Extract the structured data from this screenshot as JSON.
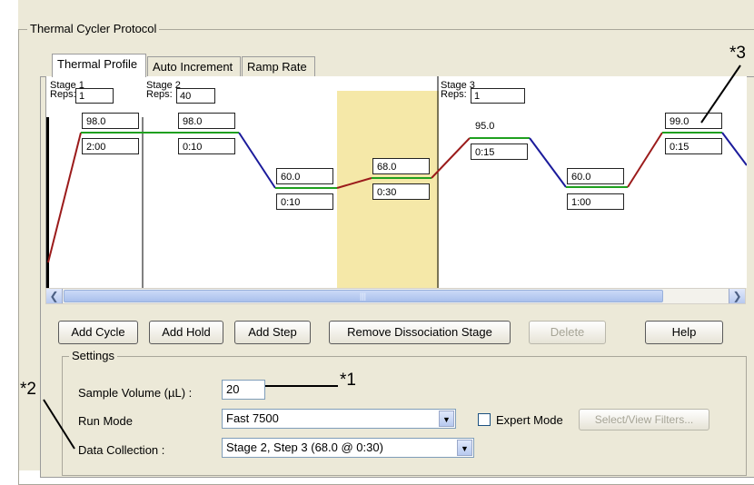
{
  "group_title": "Thermal Cycler Protocol",
  "tabs": [
    {
      "label": "Thermal Profile",
      "active": true
    },
    {
      "label": "Auto Increment",
      "active": false
    },
    {
      "label": "Ramp Rate",
      "active": false
    }
  ],
  "stages": [
    {
      "title": "Stage 1",
      "reps_label": "Reps:",
      "reps": "1"
    },
    {
      "title": "Stage 2",
      "reps_label": "Reps:",
      "reps": "40"
    },
    {
      "title": "Stage 3",
      "reps_label": "Reps:",
      "reps": "1"
    }
  ],
  "steps": [
    {
      "temp": "98.0",
      "time": "2:00"
    },
    {
      "temp": "98.0",
      "time": "0:10"
    },
    {
      "temp": "60.0",
      "time": "0:10"
    },
    {
      "temp": "68.0",
      "time": "0:30"
    },
    {
      "temp": "95.0",
      "time": "0:15"
    },
    {
      "temp": "60.0",
      "time": "1:00"
    },
    {
      "temp": "99.0",
      "time": "0:15"
    }
  ],
  "colors": {
    "hold_line": "#1fa01f",
    "ramp_up": "#9b1b1b",
    "ramp_down": "#1b1b9b",
    "highlight": "#f5e8a8"
  },
  "buttons": {
    "add_cycle": "Add Cycle",
    "add_hold": "Add Hold",
    "add_step": "Add Step",
    "remove_dissociation": "Remove Dissociation Stage",
    "delete": "Delete",
    "help": "Help"
  },
  "settings": {
    "legend": "Settings",
    "sample_volume_label": "Sample Volume (µL) :",
    "sample_volume_value": "20",
    "run_mode_label": "Run Mode",
    "run_mode_value": "Fast 7500",
    "expert_mode_label": "Expert Mode",
    "select_filters_label": "Select/View Filters...",
    "data_collection_label": "Data Collection :",
    "data_collection_value": "Stage 2, Step 3 (68.0 @ 0:30)"
  },
  "callouts": {
    "c1": "*1",
    "c2": "*2",
    "c3": "*3"
  },
  "icons": {
    "scroll_left": "chevron-left-icon",
    "scroll_right": "chevron-right-icon",
    "dropdown": "chevron-down-icon"
  }
}
